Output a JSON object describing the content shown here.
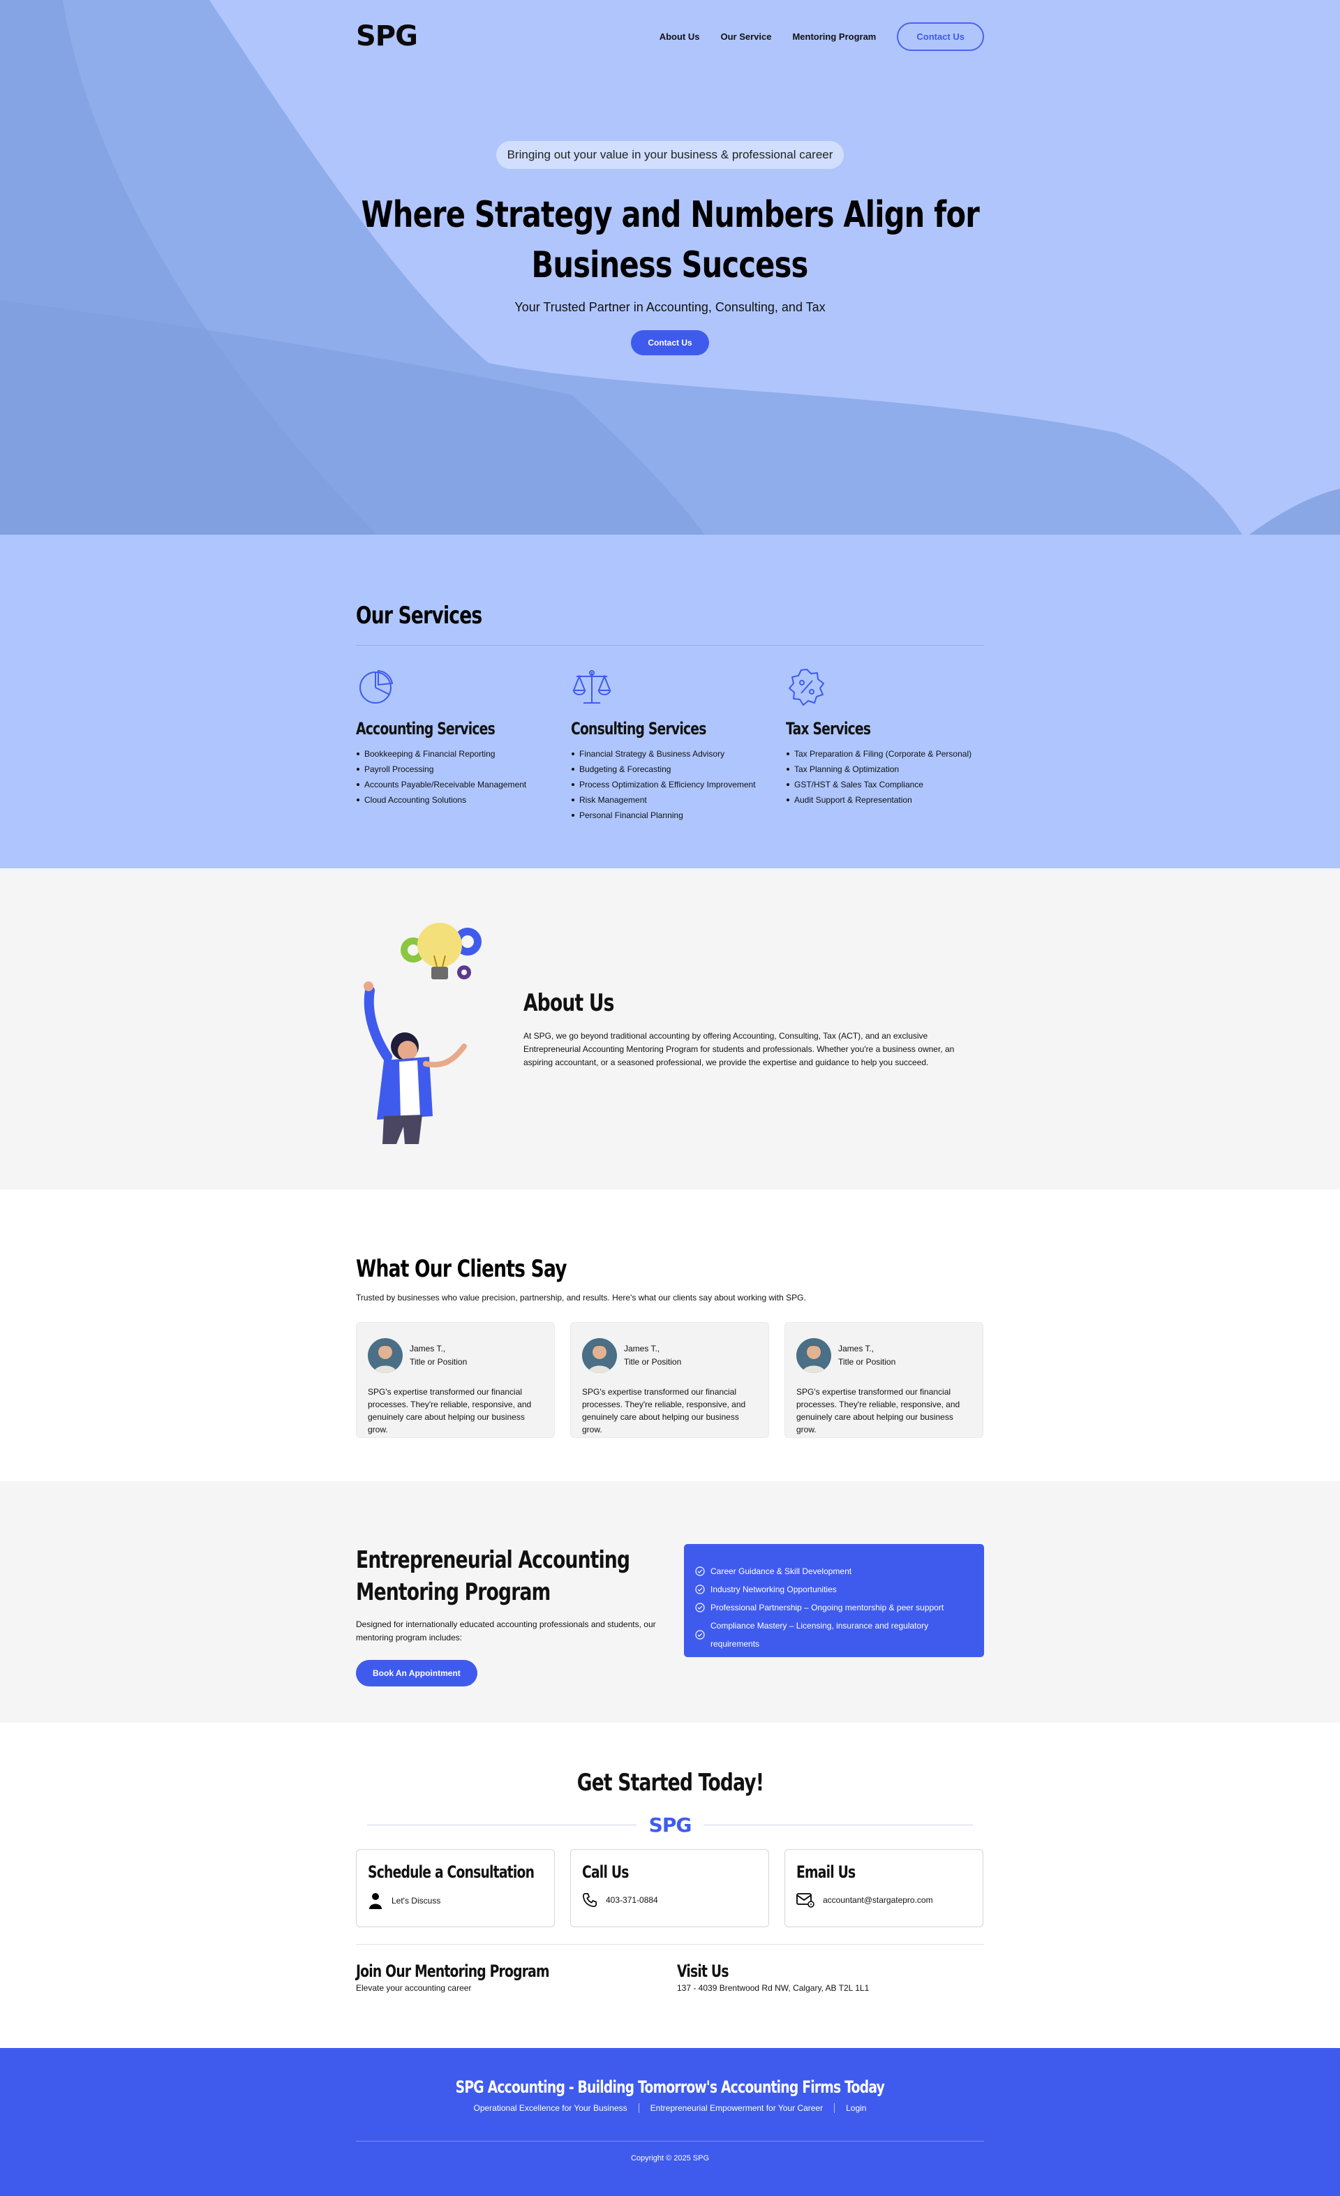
{
  "brand": {
    "logo": "SPG",
    "accent": "#3f5bee",
    "hero_bg": "#b0c5fc"
  },
  "nav": {
    "items": [
      "About Us",
      "Our Service",
      "Mentoring Program"
    ],
    "cta": "Contact Us"
  },
  "hero": {
    "pill": "Bringing out your value in your business & professional career",
    "title_line1": "Where Strategy and Numbers Align for",
    "title_line2": "Business Success",
    "subtitle": "Your Trusted Partner in Accounting, Consulting, and Tax",
    "cta": "Contact Us"
  },
  "services": {
    "title": "Our Services",
    "items": [
      {
        "icon": "pie-chart-icon",
        "title": "Accounting Services",
        "bullets": [
          "Bookkeeping & Financial Reporting",
          "Payroll Processing",
          "Accounts Payable/Receivable Management",
          "Cloud Accounting Solutions"
        ]
      },
      {
        "icon": "scales-icon",
        "title": "Consulting Services",
        "bullets": [
          "Financial Strategy & Business Advisory",
          "Budgeting & Forecasting",
          "Process Optimization & Efficiency Improvement",
          "Risk Management",
          "Personal Financial Planning"
        ]
      },
      {
        "icon": "percent-badge-icon",
        "title": "Tax Services",
        "bullets": [
          "Tax Preparation & Filing (Corporate & Personal)",
          "Tax Planning & Optimization",
          "GST/HST & Sales Tax Compliance",
          "Audit Support & Representation"
        ]
      }
    ]
  },
  "about": {
    "title": "About Us",
    "body": "At SPG, we go beyond traditional accounting by offering Accounting, Consulting, Tax (ACT), and an exclusive Entrepreneurial Accounting Mentoring Program for students and professionals. Whether you're a business owner, an aspiring accountant, or a seasoned professional, we provide the expertise and guidance to help you succeed."
  },
  "testimonials": {
    "title": "What Our Clients Say",
    "lead": "Trusted by businesses who value precision, partnership, and results. Here's what our clients say about working with SPG.",
    "items": [
      {
        "name": "James T.,",
        "role": "Title or Position",
        "quote": "SPG's expertise transformed our financial processes. They're reliable, responsive, and genuinely care about helping our business grow."
      },
      {
        "name": "James T.,",
        "role": "Title or Position",
        "quote": "SPG's expertise transformed our financial processes. They're reliable, responsive, and genuinely care about helping our business grow."
      },
      {
        "name": "James T.,",
        "role": "Title or Position",
        "quote": "SPG's expertise transformed our financial processes. They're reliable, responsive, and genuinely care about helping our business grow."
      }
    ]
  },
  "mentoring": {
    "title_line1": "Entrepreneurial Accounting",
    "title_line2": "Mentoring Program",
    "body": "Designed for internationally educated accounting professionals and students, our mentoring program includes:",
    "cta": "Book An Appointment",
    "features": [
      "Career Guidance & Skill Development",
      "Industry Networking Opportunities",
      "Professional Partnership – Ongoing mentorship & peer support",
      "Compliance Mastery – Licensing, insurance and regulatory requirements"
    ]
  },
  "contact": {
    "title": "Get Started Today!",
    "logo": "SPG",
    "cards": [
      {
        "title": "Schedule a Consultation",
        "icon": "person-icon",
        "text": "Let's Discuss"
      },
      {
        "title": "Call Us",
        "icon": "phone-icon",
        "text": "403-371-0884"
      },
      {
        "title": "Email Us",
        "icon": "mail-icon",
        "text": "accountant@stargatepro.com"
      }
    ],
    "join": {
      "title": "Join Our Mentoring Program",
      "text": "Elevate your accounting career"
    },
    "visit": {
      "title": "Visit Us",
      "text": "137 - 4039 Brentwood Rd NW, Calgary, AB T2L 1L1"
    }
  },
  "footer": {
    "title": "SPG Accounting - Building Tomorrow's Accounting Firms Today",
    "links": [
      "Operational Excellence for Your Business",
      "Entrepreneurial Empowerment for Your Career",
      "Login"
    ],
    "copyright": "Copyright © 2025 SPG"
  }
}
